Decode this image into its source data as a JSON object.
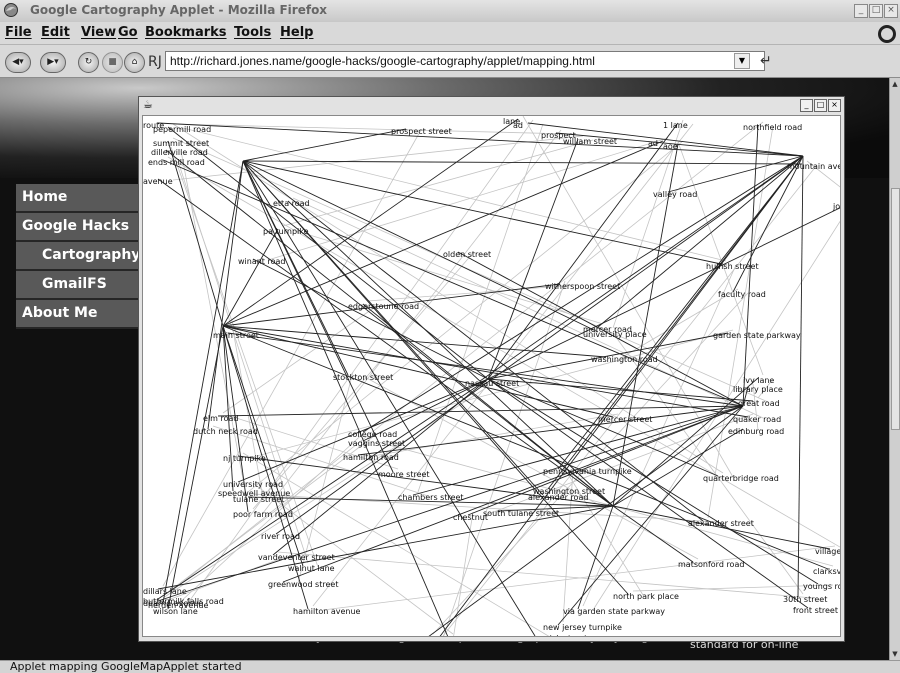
{
  "window": {
    "title": "Google Cartography Applet - Mozilla Firefox"
  },
  "menu": [
    "File",
    "Edit",
    "View",
    "Go",
    "Bookmarks",
    "Tools",
    "Help"
  ],
  "nav": {
    "url": "http://richard.jones.name/google-hacks/google-cartography/applet/mapping.html",
    "site_icon": "RJ"
  },
  "sidebar": {
    "items": [
      {
        "label": "Home",
        "sub": false
      },
      {
        "label": "Google Hacks",
        "sub": false
      },
      {
        "label": "Cartography",
        "sub": true
      },
      {
        "label": "GmailFS",
        "sub": true
      },
      {
        "label": "About Me",
        "sub": false
      }
    ]
  },
  "page_text": {
    "body_line1": "unlikely to have enough data to produce a graph. Usually anything outside",
    "right_line1": "standard for on-line"
  },
  "status": "Applet mapping GoogleMapApplet started",
  "map": {
    "hub": "nassau street",
    "streets": [
      "pepermill road",
      "summit street",
      "dillerville road",
      "ends mill road",
      "prospect street",
      "prospect",
      "william street",
      "ad",
      "aoe",
      "northfield road",
      "mountain ave",
      "valley road",
      "john",
      "pa turnpike",
      "etta road",
      "olden street",
      "hulfish street",
      "faculty road",
      "winant road",
      "witherspoon street",
      "edgerstoune road",
      "main street",
      "university place",
      "mercer road",
      "garden state parkway",
      "washington road",
      "ivy lane",
      "library place",
      "stockton street",
      "nassau street",
      "great road",
      "quaker road",
      "edinburg road",
      "elm road",
      "dutch neck road",
      "college road",
      "vaggins street",
      "mercer street",
      "nj turnpike",
      "hamilton road",
      "moore street",
      "pennsylvania turnpike",
      "university road",
      "speedwell avenue",
      "tulane street",
      "chambers street",
      "alexander road",
      "washington street",
      "quarterbridge road",
      "poor farm road",
      "south tulane street",
      "chestnut",
      "alexander street",
      "river road",
      "vandeventer street",
      "walnut lane",
      "matsonford road",
      "greenwood street",
      "north park place",
      "30th street",
      "front street",
      "hamilton avenue",
      "via garden state parkway",
      "new jersey turnpike",
      "greenwich street",
      "spruce street",
      "buttermilk falls road",
      "wilson lane",
      "dillars lane",
      "dearne avenue",
      "herden avenue",
      "route",
      "1 lane",
      "lane",
      "avenue",
      "2nd",
      "3rd",
      "ad",
      "youngs road",
      "clarksville",
      "village"
    ]
  },
  "icons": {
    "back": "back-icon",
    "forward": "forward-icon",
    "reload": "reload-icon",
    "stop": "stop-icon",
    "home": "home-icon",
    "go": "go-icon",
    "throbber": "firefox-throbber-icon"
  }
}
